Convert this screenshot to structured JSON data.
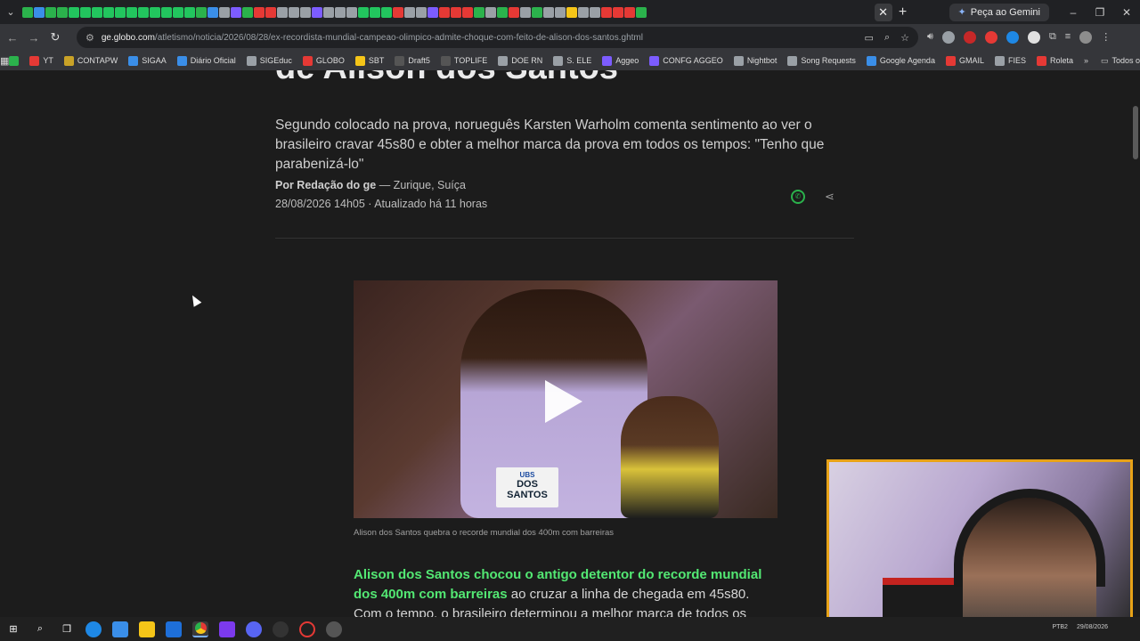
{
  "browser": {
    "gemini_label": "Peça ao Gemini",
    "url_domain": "ge.globo.com",
    "url_path": "/atletismo/noticia/2026/08/28/ex-recordista-mundial-campeao-olimpico-admite-choque-com-feito-de-alison-dos-santos.ghtml",
    "tab_favicon_colors": [
      "#2bb24c",
      "#3a8ee8",
      "#2bb24c",
      "#2bb24c",
      "#22c55e",
      "#22c55e",
      "#22c55e",
      "#22c55e",
      "#22c55e",
      "#22c55e",
      "#22c55e",
      "#22c55e",
      "#22c55e",
      "#22c55e",
      "#22c55e",
      "#2bb24c",
      "#3a8ee8",
      "#9aa0a6",
      "#7c5cff",
      "#2bb24c",
      "#e53935",
      "#e53935",
      "#9aa0a6",
      "#9aa0a6",
      "#9aa0a6",
      "#7c5cff",
      "#9aa0a6",
      "#9aa0a6",
      "#9aa0a6",
      "#22c55e",
      "#22c55e",
      "#22c55e",
      "#e53935",
      "#9aa0a6",
      "#9aa0a6",
      "#7c5cff",
      "#e53935",
      "#e53935",
      "#e53935",
      "#2bb24c",
      "#9aa0a6",
      "#2bb24c",
      "#e53935",
      "#9aa0a6",
      "#2bb24c",
      "#9aa0a6",
      "#9aa0a6",
      "#f5c518",
      "#9aa0a6",
      "#9aa0a6",
      "#e53935",
      "#e53935",
      "#e53935",
      "#2bb24c"
    ]
  },
  "bookmarks": [
    {
      "label": "",
      "color": "#2bb24c"
    },
    {
      "label": "YT",
      "color": "#e53935"
    },
    {
      "label": "CONTAPW",
      "color": "#c9a227"
    },
    {
      "label": "SIGAA",
      "color": "#3a8ee8"
    },
    {
      "label": "Diário Oficial",
      "color": "#3a8ee8"
    },
    {
      "label": "SIGEduc",
      "color": "#9aa0a6"
    },
    {
      "label": "GLOBO",
      "color": "#e53935"
    },
    {
      "label": "SBT",
      "color": "#f5c518"
    },
    {
      "label": "Draft5",
      "color": "#555555"
    },
    {
      "label": "TOPLIFE",
      "color": "#555555"
    },
    {
      "label": "DOE RN",
      "color": "#9aa0a6"
    },
    {
      "label": "S. ELE",
      "color": "#9aa0a6"
    },
    {
      "label": "Aggeo",
      "color": "#7c5cff"
    },
    {
      "label": "CONFG AGGEO",
      "color": "#7c5cff"
    },
    {
      "label": "Nightbot",
      "color": "#9aa0a6"
    },
    {
      "label": "Song Requests",
      "color": "#9aa0a6"
    },
    {
      "label": "Google Agenda",
      "color": "#3a8ee8"
    },
    {
      "label": "GMAIL",
      "color": "#e53935"
    },
    {
      "label": "FIES",
      "color": "#9aa0a6"
    },
    {
      "label": "Roleta",
      "color": "#e53935"
    }
  ],
  "bookmarks_all": "Todos os favoritos",
  "article": {
    "headline_fragment": "de Alison dos Santos",
    "subtitle": "Segundo colocado na prova, norueguês Karsten Warholm comenta sentimento ao ver o brasileiro cravar 45s80 e obter a melhor marca da prova em todos os tempos: \"Tenho que parabenizá-lo\"",
    "byline_author": "Por Redação do ge",
    "byline_location": " — Zurique, Suíça",
    "dateline": "28/08/2026 14h05 · Atualizado há 11 horas",
    "video_bib_sponsor": "UBS",
    "video_bib_name": "DOS SANTOS",
    "caption": "Alison dos Santos quebra o recorde mundial dos 400m com barreiras",
    "body_highlight": "Alison dos Santos chocou o antigo detentor do recorde mundial dos 400m com barreiras",
    "body_rest": " ao cruzar a linha de chegada em 45s80. Com o tempo, o brasileiro determinou a melhor marca de todos os tempos na"
  },
  "taskbar": {
    "lang": "PTB2",
    "date": "29/08/2026"
  },
  "colors": {
    "accent_green": "#53e873",
    "webcam_border": "#e8a317"
  }
}
